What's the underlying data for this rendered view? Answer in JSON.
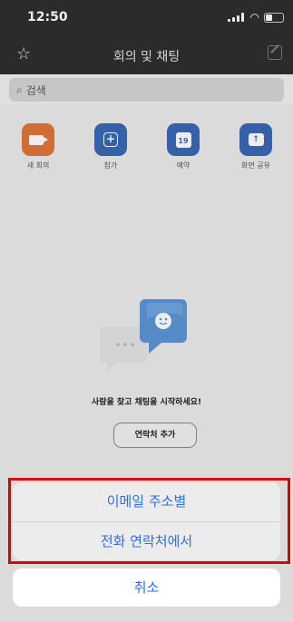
{
  "status": {
    "time": "12:50"
  },
  "nav": {
    "title": "회의 및 채팅"
  },
  "search": {
    "placeholder": "검색"
  },
  "actions": [
    {
      "label": "새 회의",
      "color": "#e0763a"
    },
    {
      "label": "참가",
      "color": "#3a69b8"
    },
    {
      "label": "예약",
      "color": "#3a69b8",
      "calendar_day": "19"
    },
    {
      "label": "화면 공유",
      "color": "#3a69b8"
    }
  ],
  "empty": {
    "message": "사람을 찾고 채팅을 시작하세요!",
    "add_contact": "연락처 추가"
  },
  "sheet": {
    "option1": "이메일 주소별",
    "option2": "전화 연락처에서",
    "cancel": "취소"
  },
  "colors": {
    "accent_blue": "#2f6fe0",
    "highlight_red": "#e00000",
    "navbar_bg": "#2f2f30"
  }
}
